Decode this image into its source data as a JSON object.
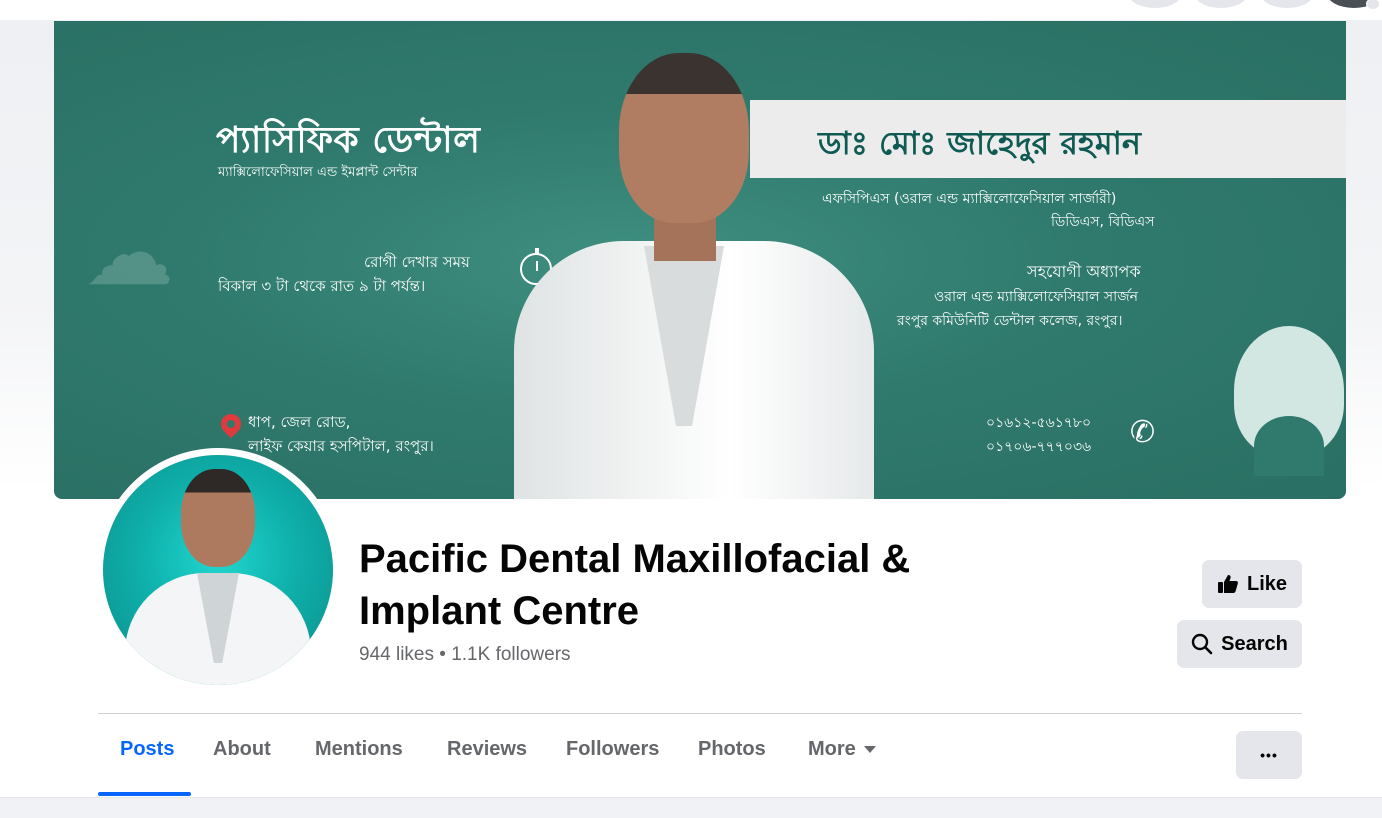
{
  "cover": {
    "clinic_name_bn": "প্যাসিফিক ডেন্টাল",
    "clinic_subtitle_bn": "ম্যাক্সিলোফেসিয়াল এন্ড ইমপ্লান্ট সেন্টার",
    "visiting_label": "রোগী দেখার সময়",
    "visiting_time": "বিকাল ৩ টা থেকে রাত ৯ টা পর্যন্ত।",
    "address_line1": "ধাপ, জেল রোড,",
    "address_line2": "লাইফ কেয়ার হসপিটাল, রংপুর।",
    "doctor_name_bn": "ডাঃ মোঃ জাহেদুর রহমান",
    "qualification_1": "এফসিপিএস (ওরাল এন্ড ম্যাক্সিলোফেসিয়াল সার্জারী)",
    "qualification_2": "ডিডিএস, বিডিএস",
    "designation": "সহযোগী অধ্যাপক",
    "designation_dept": "ওরাল এন্ড ম্যাক্সিলোফেসিয়াল সার্জন",
    "designation_inst": "রংপুর কমিউনিটি ডেন্টাল কলেজ, রংপুর।",
    "phone_1": "০১৬১২-৫৬১৭৮০",
    "phone_2": "০১৭০৬-৭৭৭০৩৬"
  },
  "page": {
    "name": "Pacific Dental Maxillofacial & Implant Centre",
    "stats": "944 likes • 1.1K followers"
  },
  "actions": {
    "like_label": "Like",
    "search_label": "Search",
    "more_label": "•••"
  },
  "tabs": [
    {
      "label": "Posts"
    },
    {
      "label": "About"
    },
    {
      "label": "Mentions"
    },
    {
      "label": "Reviews"
    },
    {
      "label": "Followers"
    },
    {
      "label": "Photos"
    },
    {
      "label": "More"
    }
  ],
  "colors": {
    "accent": "#0866ff",
    "cover_teal": "#2f7a6d",
    "button_bg": "#e4e6eb",
    "muted_text": "#65676b"
  }
}
